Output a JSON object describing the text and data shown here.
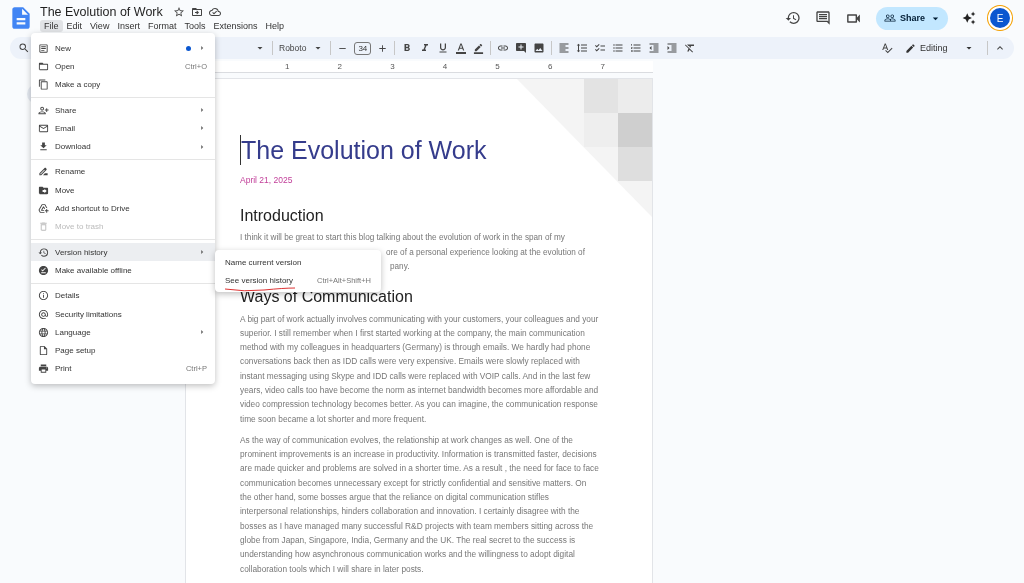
{
  "header": {
    "title": "The Evolution of Work",
    "share": "Share",
    "avatar": "E"
  },
  "menubar": [
    {
      "label": "File",
      "selected": true
    },
    {
      "label": "Edit",
      "selected": false
    },
    {
      "label": "View",
      "selected": false
    },
    {
      "label": "Insert",
      "selected": false
    },
    {
      "label": "Format",
      "selected": false
    },
    {
      "label": "Tools",
      "selected": false
    },
    {
      "label": "Extensions",
      "selected": false
    },
    {
      "label": "Help",
      "selected": false
    }
  ],
  "toolbar": {
    "font": "Roboto",
    "font_size": "34",
    "mode": "Editing"
  },
  "ruler": [
    "1",
    "2",
    "3",
    "4",
    "5",
    "6",
    "7"
  ],
  "document": {
    "title": "The Evolution of Work",
    "date": "April 21, 2025",
    "intro_heading": "Introduction",
    "intro_lines": [
      "I think it will be great to start this blog talking about the evolution of work in the span of my",
      "ore of a personal experience looking at the evolution of",
      "pany."
    ],
    "heading": "Ways of Communication",
    "paragraphs": [
      "A big part of work actually involves communicating with your customers, your colleagues and your superior. I still remember when I first started working at the company, the main communication method with my colleagues in headquarters (Germany) is through emails. We hardly had phone conversations back then as IDD calls were very expensive. Emails were slowly replaced with instant messaging using Skype and IDD calls were replaced with VOIP calls. And in the last few years, video calls too have become the norm as internet bandwidth becomes more affordable and video compression technology becomes better. As you can imagine, the communication response time soon became a lot shorter and more frequent.",
      "As the way of communication evolves, the relationship at work changes as well. One of the prominent improvements is an increase in productivity. Information is transmitted faster, decisions are made quicker and problems are solved in a shorter time. As a result , the need for face to face communication becomes unnecessary except for strictly confidential and sensitive matters. On the other hand, some bosses argue that the reliance on digital communication stifles interpersonal relationships, hinders collaboration and innovation. I certainly disagree with the bosses as I have managed many successful R&D projects with team members sitting across the globe from Japan, Singapore, India, Germany and the UK. The real secret to the success is understanding how asynchronous communication works and the willingness to adopt digital collaboration tools which I will share in later posts."
    ]
  },
  "file_menu": [
    [
      {
        "label": "New",
        "kind": "submenu-dot",
        "disabled": false,
        "selected": false
      },
      {
        "label": "Open",
        "kind": "shortcut",
        "shortcut": "Ctrl+O",
        "disabled": false,
        "selected": false
      },
      {
        "label": "Make a copy",
        "kind": "action",
        "disabled": false,
        "selected": false
      }
    ],
    [
      {
        "label": "Share",
        "kind": "submenu",
        "disabled": false,
        "selected": false
      },
      {
        "label": "Email",
        "kind": "submenu",
        "disabled": false,
        "selected": false
      },
      {
        "label": "Download",
        "kind": "submenu",
        "disabled": false,
        "selected": false
      }
    ],
    [
      {
        "label": "Rename",
        "kind": "action",
        "disabled": false,
        "selected": false
      },
      {
        "label": "Move",
        "kind": "action",
        "disabled": false,
        "selected": false
      },
      {
        "label": "Add shortcut to Drive",
        "kind": "action",
        "disabled": false,
        "selected": false
      },
      {
        "label": "Move to trash",
        "kind": "action",
        "disabled": true,
        "selected": false
      }
    ],
    [
      {
        "label": "Version history",
        "kind": "submenu",
        "disabled": false,
        "selected": true
      },
      {
        "label": "Make available offline",
        "kind": "action",
        "disabled": false,
        "selected": false
      }
    ],
    [
      {
        "label": "Details",
        "kind": "action",
        "disabled": false,
        "selected": false
      },
      {
        "label": "Security limitations",
        "kind": "action",
        "disabled": false,
        "selected": false
      },
      {
        "label": "Language",
        "kind": "submenu",
        "disabled": false,
        "selected": false
      },
      {
        "label": "Page setup",
        "kind": "action",
        "disabled": false,
        "selected": false
      },
      {
        "label": "Print",
        "kind": "shortcut",
        "shortcut": "Ctrl+P",
        "disabled": false,
        "selected": false
      }
    ]
  ],
  "version_submenu": [
    {
      "label": "Name current version",
      "underlined": false
    },
    {
      "label": "See version history",
      "shortcut": "Ctrl+Alt+Shift+H",
      "underlined": true
    }
  ]
}
